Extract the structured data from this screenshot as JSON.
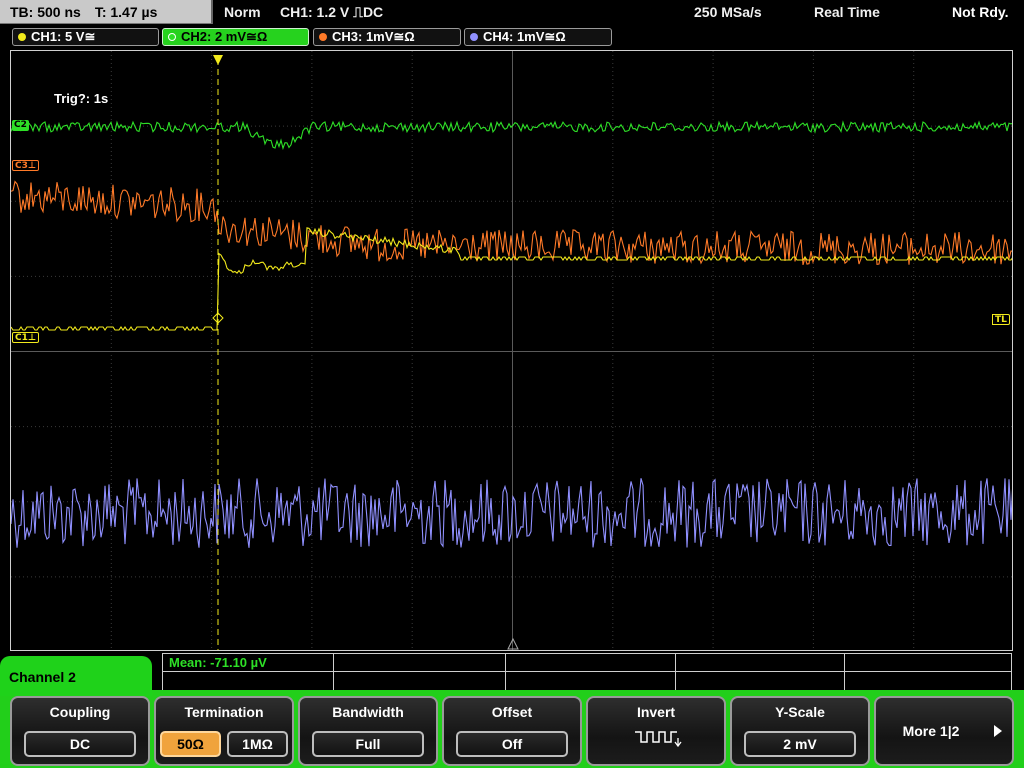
{
  "topbar": {
    "timebase": "TB: 500 ns",
    "trigger_time": "T: 1.47 µs",
    "trigger_mode": "Norm",
    "trigger_source": "CH1: 1.2 V ⎍DC",
    "sample_rate": "250 MSa/s",
    "acquisition": "Real Time",
    "state": "Not Rdy."
  },
  "channels": [
    {
      "label": "CH1: 5 V≅",
      "color": "#f2ea1c"
    },
    {
      "label": "CH2: 2 mV≅Ω",
      "color": "#2ee027"
    },
    {
      "label": "CH3: 1mV≅Ω",
      "color": "#ff7a28"
    },
    {
      "label": "CH4: 1mV≅Ω",
      "color": "#9090ff"
    }
  ],
  "plot": {
    "trigger_status": "Trig?: 1s",
    "markers": {
      "ch2": "C2",
      "ch3": "C3⊥",
      "ch1": "C1⊥",
      "trigger_level": "TL"
    }
  },
  "measurement": {
    "text": "Mean: -71.10 µV"
  },
  "menu": {
    "channel_label": "Channel 2",
    "coupling": {
      "title": "Coupling",
      "value": "DC"
    },
    "termination": {
      "title": "Termination",
      "options": [
        "50Ω",
        "1MΩ"
      ],
      "selected": "50Ω"
    },
    "bandwidth": {
      "title": "Bandwidth",
      "value": "Full"
    },
    "offset": {
      "title": "Offset",
      "value": "Off"
    },
    "invert": {
      "title": "Invert",
      "icon": "invert-waveform-icon"
    },
    "yscale": {
      "title": "Y-Scale",
      "value": "2 mV"
    },
    "more": {
      "label": "More 1|2"
    }
  }
}
